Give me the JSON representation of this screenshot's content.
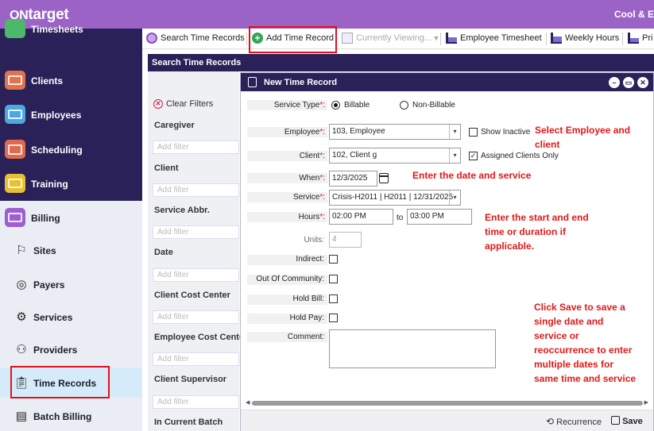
{
  "app": {
    "logo_prefix": "ON",
    "logo_suffix": "target",
    "company": "Cool & E"
  },
  "sidebar": {
    "top_items": [
      {
        "label": "Timesheets",
        "color": "#4bb86a"
      },
      {
        "label": "Clients",
        "color": "#e0734d"
      },
      {
        "label": "Employees",
        "color": "#4aa9e0"
      },
      {
        "label": "Scheduling",
        "color": "#e06a4d"
      },
      {
        "label": "Training",
        "color": "#e8c030"
      },
      {
        "label": "Billing",
        "color": "#9d5fd0"
      }
    ],
    "sub_items": [
      {
        "label": "Sites",
        "icon": "site-icon"
      },
      {
        "label": "Payers",
        "icon": "payers-icon"
      },
      {
        "label": "Services",
        "icon": "services-icon"
      },
      {
        "label": "Providers",
        "icon": "providers-icon"
      },
      {
        "label": "Time Records",
        "icon": "clipboard-icon"
      },
      {
        "label": "Batch Billing",
        "icon": "batch-billing-icon"
      }
    ]
  },
  "toolbar": {
    "search": "Search Time Records",
    "add": "Add Time Record",
    "currently_viewing": "Currently Viewing...",
    "employee_timesheet": "Employee Timesheet",
    "weekly_hours": "Weekly Hours",
    "print": "Pri"
  },
  "search_panel": {
    "title": "Search Time Records",
    "clear_filters": "Clear Filters",
    "filters": [
      {
        "label": "Caregiver",
        "placeholder": "Add filter"
      },
      {
        "label": "Client",
        "placeholder": "Add filter"
      },
      {
        "label": "Service Abbr.",
        "placeholder": "Add filter"
      },
      {
        "label": "Date",
        "placeholder": "Add filter"
      },
      {
        "label": "Client Cost Center",
        "placeholder": "Add filter"
      },
      {
        "label": "Employee Cost Center",
        "placeholder": "Add filter"
      },
      {
        "label": "Client Supervisor",
        "placeholder": "Add filter"
      },
      {
        "label": "In Current Batch",
        "placeholder": ""
      }
    ]
  },
  "dialog": {
    "title": "New Time Record",
    "service_type_label": "Service Type",
    "billable": "Billable",
    "non_billable": "Non-Billable",
    "employee_label": "Employee",
    "employee_value": "103, Employee",
    "show_inactive": "Show Inactive",
    "client_label": "Client",
    "client_value": "102, Client g",
    "assigned_clients_only": "Assigned Clients Only",
    "when_label": "When",
    "when_value": "12/3/2025",
    "service_label": "Service",
    "service_value": "Crisis-H2011 | H2011 | 12/31/2025",
    "hours_label": "Hours",
    "hours_from": "02:00 PM",
    "hours_to_word": "to",
    "hours_to": "03:00 PM",
    "units_label": "Units:",
    "units_value": "4",
    "indirect_label": "Indirect:",
    "out_of_community_label": "Out Of Community:",
    "hold_bill_label": "Hold Bill:",
    "hold_pay_label": "Hold Pay:",
    "comment_label": "Comment:",
    "recurrence": "Recurrence",
    "save": "Save"
  },
  "annotations": {
    "a1_line1": "Select Employee and",
    "a1_line2": "client",
    "a2": "Enter the date and service",
    "a3_line1": "Enter the start and end",
    "a3_line2": "time or duration if",
    "a3_line3": "applicable.",
    "a4_line1": "Click Save to save a",
    "a4_line2": "single date and",
    "a4_line3": "service or",
    "a4_line4": "reoccurrence to enter",
    "a4_line5": "multiple dates for",
    "a4_line6": "same time and service"
  },
  "colors": {
    "brand": "#9b63c6",
    "nav_dark": "#2a2158",
    "annotation": "#e11818"
  }
}
